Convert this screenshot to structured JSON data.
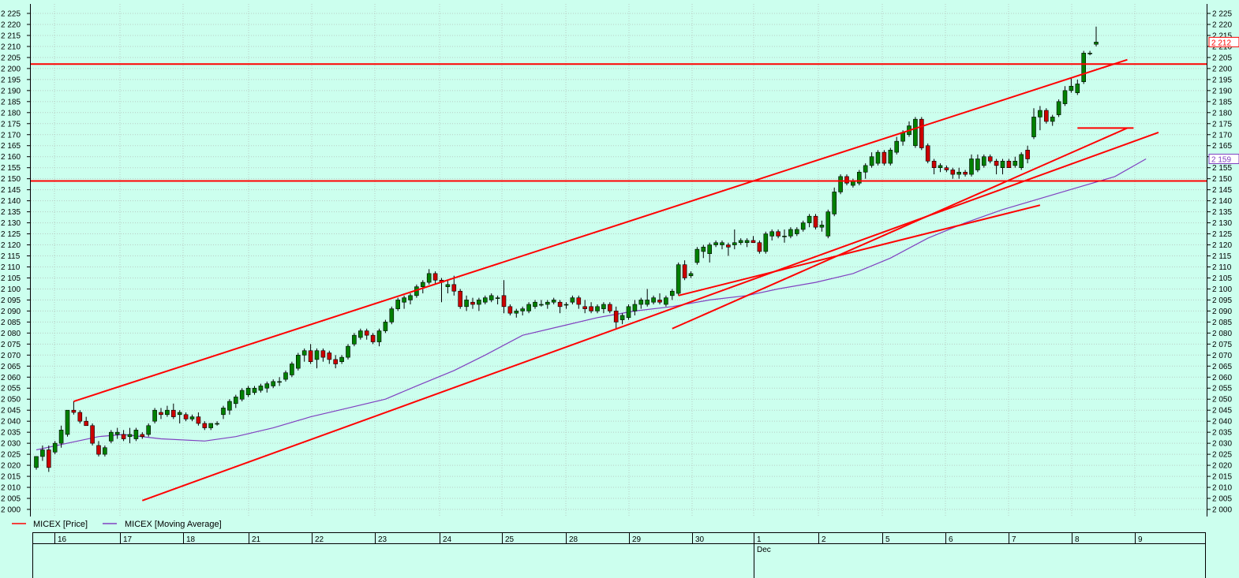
{
  "chart_data": {
    "type": "candlestick",
    "ylim": [
      2000,
      2225
    ],
    "ytick_step": 5,
    "y_tick_labels_left": [
      "2 000",
      "2 005",
      "2 010",
      "2 015",
      "2 020",
      "2 025",
      "2 030",
      "2 035",
      "2 040",
      "2 045",
      "2 050",
      "2 055",
      "2 060",
      "2 065",
      "2 070",
      "2 075",
      "2 080",
      "2 085",
      "2 090",
      "2 095",
      "2 100",
      "2 105",
      "2 110",
      "2 115",
      "2 120",
      "2 125",
      "2 130",
      "2 135",
      "2 140",
      "2 145",
      "2 150",
      "2 155",
      "2 160",
      "2 165",
      "2 170",
      "2 175",
      "2 180",
      "2 185",
      "2 190",
      "2 195",
      "2 200",
      "2 205",
      "2 210",
      "2 215",
      "2 220",
      "2 225"
    ],
    "grid": true,
    "legend": [
      {
        "name": "MICEX [Price]",
        "color": "#FF0000"
      },
      {
        "name": "MICEX [Moving Average]",
        "color": "#8040C0"
      }
    ],
    "date_labels": [
      "16",
      "17",
      "18",
      "21",
      "22",
      "23",
      "24",
      "25",
      "28",
      "29",
      "30",
      "1",
      "2",
      "5",
      "6",
      "7",
      "8",
      "9"
    ],
    "month_label": "Dec",
    "month_label_at": "1",
    "last_price_label": "2 212",
    "ma_value_label": "2 159",
    "candles": [
      {
        "o": 2019,
        "h": 2024,
        "l": 2018,
        "c": 2024
      },
      {
        "o": 2024,
        "h": 2029,
        "l": 2022,
        "c": 2027
      },
      {
        "o": 2027,
        "h": 2029,
        "l": 2017,
        "c": 2019
      },
      {
        "o": 2026,
        "h": 2031,
        "l": 2025,
        "c": 2030
      },
      {
        "o": 2030,
        "h": 2038,
        "l": 2028,
        "c": 2036
      },
      {
        "o": 2034,
        "h": 2045,
        "l": 2033,
        "c": 2045
      },
      {
        "o": 2045,
        "h": 2049,
        "l": 2043,
        "c": 2044
      },
      {
        "o": 2044,
        "h": 2045,
        "l": 2039,
        "c": 2040
      },
      {
        "o": 2040,
        "h": 2042,
        "l": 2038,
        "c": 2038
      },
      {
        "o": 2038,
        "h": 2039,
        "l": 2029,
        "c": 2030
      },
      {
        "o": 2029,
        "h": 2031,
        "l": 2024,
        "c": 2025
      },
      {
        "o": 2025,
        "h": 2029,
        "l": 2024,
        "c": 2028
      },
      {
        "o": 2031,
        "h": 2036,
        "l": 2030,
        "c": 2035
      },
      {
        "o": 2034,
        "h": 2037,
        "l": 2032,
        "c": 2035
      },
      {
        "o": 2034,
        "h": 2036,
        "l": 2031,
        "c": 2032
      },
      {
        "o": 2033,
        "h": 2037,
        "l": 2030,
        "c": 2034
      },
      {
        "o": 2032,
        "h": 2037,
        "l": 2031,
        "c": 2036
      },
      {
        "o": 2034,
        "h": 2035,
        "l": 2032,
        "c": 2033
      },
      {
        "o": 2034,
        "h": 2039,
        "l": 2033,
        "c": 2038
      },
      {
        "o": 2040,
        "h": 2046,
        "l": 2039,
        "c": 2045
      },
      {
        "o": 2044,
        "h": 2046,
        "l": 2041,
        "c": 2043
      },
      {
        "o": 2043,
        "h": 2047,
        "l": 2042,
        "c": 2045
      },
      {
        "o": 2045,
        "h": 2048,
        "l": 2041,
        "c": 2042
      },
      {
        "o": 2043,
        "h": 2045,
        "l": 2039,
        "c": 2044
      },
      {
        "o": 2043,
        "h": 2044,
        "l": 2040,
        "c": 2041
      },
      {
        "o": 2041,
        "h": 2043,
        "l": 2040,
        "c": 2042
      },
      {
        "o": 2042,
        "h": 2044,
        "l": 2038,
        "c": 2039
      },
      {
        "o": 2039,
        "h": 2040,
        "l": 2036,
        "c": 2037
      },
      {
        "o": 2037,
        "h": 2039,
        "l": 2036,
        "c": 2039
      },
      {
        "o": 2039,
        "h": 2040,
        "l": 2038,
        "c": 2039
      },
      {
        "o": 2043,
        "h": 2047,
        "l": 2041,
        "c": 2046
      },
      {
        "o": 2045,
        "h": 2050,
        "l": 2043,
        "c": 2049
      },
      {
        "o": 2048,
        "h": 2052,
        "l": 2046,
        "c": 2051
      },
      {
        "o": 2050,
        "h": 2055,
        "l": 2049,
        "c": 2054
      },
      {
        "o": 2052,
        "h": 2056,
        "l": 2051,
        "c": 2055
      },
      {
        "o": 2053,
        "h": 2056,
        "l": 2052,
        "c": 2055
      },
      {
        "o": 2054,
        "h": 2057,
        "l": 2053,
        "c": 2056
      },
      {
        "o": 2055,
        "h": 2058,
        "l": 2053,
        "c": 2057
      },
      {
        "o": 2056,
        "h": 2059,
        "l": 2055,
        "c": 2058
      },
      {
        "o": 2058,
        "h": 2060,
        "l": 2056,
        "c": 2058
      },
      {
        "o": 2059,
        "h": 2063,
        "l": 2058,
        "c": 2062
      },
      {
        "o": 2061,
        "h": 2067,
        "l": 2060,
        "c": 2066
      },
      {
        "o": 2064,
        "h": 2071,
        "l": 2063,
        "c": 2070
      },
      {
        "o": 2070,
        "h": 2073,
        "l": 2067,
        "c": 2072
      },
      {
        "o": 2072,
        "h": 2075,
        "l": 2066,
        "c": 2067
      },
      {
        "o": 2068,
        "h": 2073,
        "l": 2064,
        "c": 2072
      },
      {
        "o": 2072,
        "h": 2073,
        "l": 2067,
        "c": 2069
      },
      {
        "o": 2071,
        "h": 2072,
        "l": 2066,
        "c": 2068
      },
      {
        "o": 2068,
        "h": 2070,
        "l": 2064,
        "c": 2066
      },
      {
        "o": 2067,
        "h": 2070,
        "l": 2066,
        "c": 2069
      },
      {
        "o": 2069,
        "h": 2075,
        "l": 2068,
        "c": 2074
      },
      {
        "o": 2075,
        "h": 2080,
        "l": 2074,
        "c": 2079
      },
      {
        "o": 2078,
        "h": 2082,
        "l": 2077,
        "c": 2081
      },
      {
        "o": 2081,
        "h": 2082,
        "l": 2077,
        "c": 2079
      },
      {
        "o": 2079,
        "h": 2080,
        "l": 2075,
        "c": 2076
      },
      {
        "o": 2076,
        "h": 2082,
        "l": 2074,
        "c": 2081
      },
      {
        "o": 2081,
        "h": 2086,
        "l": 2080,
        "c": 2085
      },
      {
        "o": 2085,
        "h": 2092,
        "l": 2084,
        "c": 2091
      },
      {
        "o": 2091,
        "h": 2096,
        "l": 2090,
        "c": 2095
      },
      {
        "o": 2094,
        "h": 2097,
        "l": 2091,
        "c": 2096
      },
      {
        "o": 2095,
        "h": 2098,
        "l": 2093,
        "c": 2097
      },
      {
        "o": 2097,
        "h": 2102,
        "l": 2096,
        "c": 2101
      },
      {
        "o": 2101,
        "h": 2104,
        "l": 2098,
        "c": 2103
      },
      {
        "o": 2103,
        "h": 2109,
        "l": 2102,
        "c": 2107
      },
      {
        "o": 2107,
        "h": 2108,
        "l": 2102,
        "c": 2104
      },
      {
        "o": 2104,
        "h": 2105,
        "l": 2094,
        "c": 2103
      },
      {
        "o": 2101,
        "h": 2104,
        "l": 2098,
        "c": 2102
      },
      {
        "o": 2102,
        "h": 2106,
        "l": 2097,
        "c": 2099
      },
      {
        "o": 2099,
        "h": 2100,
        "l": 2091,
        "c": 2092
      },
      {
        "o": 2092,
        "h": 2097,
        "l": 2090,
        "c": 2095
      },
      {
        "o": 2094,
        "h": 2096,
        "l": 2091,
        "c": 2093
      },
      {
        "o": 2093,
        "h": 2096,
        "l": 2090,
        "c": 2095
      },
      {
        "o": 2094,
        "h": 2097,
        "l": 2093,
        "c": 2096
      },
      {
        "o": 2095,
        "h": 2098,
        "l": 2094,
        "c": 2097
      },
      {
        "o": 2096,
        "h": 2097,
        "l": 2093,
        "c": 2096
      },
      {
        "o": 2097,
        "h": 2104,
        "l": 2089,
        "c": 2092
      },
      {
        "o": 2092,
        "h": 2093,
        "l": 2088,
        "c": 2089
      },
      {
        "o": 2089,
        "h": 2091,
        "l": 2087,
        "c": 2090
      },
      {
        "o": 2090,
        "h": 2092,
        "l": 2088,
        "c": 2091
      },
      {
        "o": 2090,
        "h": 2094,
        "l": 2089,
        "c": 2093
      },
      {
        "o": 2092,
        "h": 2095,
        "l": 2091,
        "c": 2094
      },
      {
        "o": 2093,
        "h": 2095,
        "l": 2092,
        "c": 2093
      },
      {
        "o": 2093,
        "h": 2095,
        "l": 2091,
        "c": 2094
      },
      {
        "o": 2094,
        "h": 2096,
        "l": 2093,
        "c": 2095
      },
      {
        "o": 2094,
        "h": 2095,
        "l": 2089,
        "c": 2092
      },
      {
        "o": 2093,
        "h": 2094,
        "l": 2091,
        "c": 2093
      },
      {
        "o": 2094,
        "h": 2097,
        "l": 2093,
        "c": 2096
      },
      {
        "o": 2096,
        "h": 2097,
        "l": 2091,
        "c": 2093
      },
      {
        "o": 2092,
        "h": 2095,
        "l": 2089,
        "c": 2091
      },
      {
        "o": 2092,
        "h": 2094,
        "l": 2089,
        "c": 2090
      },
      {
        "o": 2090,
        "h": 2093,
        "l": 2089,
        "c": 2092
      },
      {
        "o": 2091,
        "h": 2094,
        "l": 2089,
        "c": 2093
      },
      {
        "o": 2093,
        "h": 2094,
        "l": 2089,
        "c": 2090
      },
      {
        "o": 2090,
        "h": 2092,
        "l": 2082,
        "c": 2085
      },
      {
        "o": 2086,
        "h": 2089,
        "l": 2084,
        "c": 2088
      },
      {
        "o": 2087,
        "h": 2093,
        "l": 2086,
        "c": 2092
      },
      {
        "o": 2090,
        "h": 2095,
        "l": 2088,
        "c": 2093
      },
      {
        "o": 2093,
        "h": 2096,
        "l": 2091,
        "c": 2095
      },
      {
        "o": 2093,
        "h": 2100,
        "l": 2092,
        "c": 2095
      },
      {
        "o": 2094,
        "h": 2097,
        "l": 2093,
        "c": 2096
      },
      {
        "o": 2095,
        "h": 2098,
        "l": 2093,
        "c": 2094
      },
      {
        "o": 2093,
        "h": 2097,
        "l": 2092,
        "c": 2096
      },
      {
        "o": 2097,
        "h": 2100,
        "l": 2095,
        "c": 2099
      },
      {
        "o": 2098,
        "h": 2112,
        "l": 2097,
        "c": 2111
      },
      {
        "o": 2111,
        "h": 2113,
        "l": 2104,
        "c": 2105
      },
      {
        "o": 2106,
        "h": 2108,
        "l": 2105,
        "c": 2107
      },
      {
        "o": 2112,
        "h": 2119,
        "l": 2111,
        "c": 2118
      },
      {
        "o": 2117,
        "h": 2120,
        "l": 2114,
        "c": 2119
      },
      {
        "o": 2116,
        "h": 2121,
        "l": 2112,
        "c": 2120
      },
      {
        "o": 2120,
        "h": 2122,
        "l": 2119,
        "c": 2121
      },
      {
        "o": 2120,
        "h": 2122,
        "l": 2118,
        "c": 2121
      },
      {
        "o": 2120,
        "h": 2121,
        "l": 2115,
        "c": 2119
      },
      {
        "o": 2120,
        "h": 2127,
        "l": 2118,
        "c": 2121
      },
      {
        "o": 2121,
        "h": 2123,
        "l": 2120,
        "c": 2122
      },
      {
        "o": 2121,
        "h": 2123,
        "l": 2119,
        "c": 2122
      },
      {
        "o": 2122,
        "h": 2124,
        "l": 2121,
        "c": 2121
      },
      {
        "o": 2121,
        "h": 2122,
        "l": 2116,
        "c": 2117
      },
      {
        "o": 2117,
        "h": 2126,
        "l": 2116,
        "c": 2125
      },
      {
        "o": 2124,
        "h": 2127,
        "l": 2122,
        "c": 2126
      },
      {
        "o": 2126,
        "h": 2127,
        "l": 2123,
        "c": 2124
      },
      {
        "o": 2124,
        "h": 2127,
        "l": 2121,
        "c": 2124
      },
      {
        "o": 2124,
        "h": 2128,
        "l": 2123,
        "c": 2127
      },
      {
        "o": 2125,
        "h": 2128,
        "l": 2124,
        "c": 2127
      },
      {
        "o": 2127,
        "h": 2131,
        "l": 2126,
        "c": 2130
      },
      {
        "o": 2130,
        "h": 2134,
        "l": 2128,
        "c": 2133
      },
      {
        "o": 2133,
        "h": 2134,
        "l": 2127,
        "c": 2128
      },
      {
        "o": 2128,
        "h": 2131,
        "l": 2126,
        "c": 2129
      },
      {
        "o": 2124,
        "h": 2136,
        "l": 2123,
        "c": 2135
      },
      {
        "o": 2134,
        "h": 2146,
        "l": 2133,
        "c": 2144
      },
      {
        "o": 2144,
        "h": 2152,
        "l": 2143,
        "c": 2151
      },
      {
        "o": 2151,
        "h": 2152,
        "l": 2147,
        "c": 2148
      },
      {
        "o": 2147,
        "h": 2150,
        "l": 2146,
        "c": 2149
      },
      {
        "o": 2148,
        "h": 2154,
        "l": 2147,
        "c": 2153
      },
      {
        "o": 2153,
        "h": 2157,
        "l": 2150,
        "c": 2156
      },
      {
        "o": 2156,
        "h": 2162,
        "l": 2155,
        "c": 2160
      },
      {
        "o": 2157,
        "h": 2163,
        "l": 2156,
        "c": 2162
      },
      {
        "o": 2162,
        "h": 2163,
        "l": 2156,
        "c": 2157
      },
      {
        "o": 2157,
        "h": 2164,
        "l": 2156,
        "c": 2163
      },
      {
        "o": 2162,
        "h": 2169,
        "l": 2161,
        "c": 2167
      },
      {
        "o": 2167,
        "h": 2172,
        "l": 2165,
        "c": 2171
      },
      {
        "o": 2170,
        "h": 2176,
        "l": 2169,
        "c": 2174
      },
      {
        "o": 2165,
        "h": 2178,
        "l": 2164,
        "c": 2177
      },
      {
        "o": 2177,
        "h": 2178,
        "l": 2163,
        "c": 2164
      },
      {
        "o": 2165,
        "h": 2166,
        "l": 2157,
        "c": 2158
      },
      {
        "o": 2158,
        "h": 2159,
        "l": 2152,
        "c": 2155
      },
      {
        "o": 2155,
        "h": 2157,
        "l": 2153,
        "c": 2156
      },
      {
        "o": 2155,
        "h": 2156,
        "l": 2153,
        "c": 2154
      },
      {
        "o": 2154,
        "h": 2155,
        "l": 2150,
        "c": 2152
      },
      {
        "o": 2152,
        "h": 2155,
        "l": 2150,
        "c": 2153
      },
      {
        "o": 2153,
        "h": 2154,
        "l": 2151,
        "c": 2152
      },
      {
        "o": 2152,
        "h": 2161,
        "l": 2151,
        "c": 2159
      },
      {
        "o": 2154,
        "h": 2161,
        "l": 2153,
        "c": 2159
      },
      {
        "o": 2156,
        "h": 2161,
        "l": 2155,
        "c": 2160
      },
      {
        "o": 2160,
        "h": 2161,
        "l": 2157,
        "c": 2158
      },
      {
        "o": 2158,
        "h": 2159,
        "l": 2152,
        "c": 2156
      },
      {
        "o": 2155,
        "h": 2159,
        "l": 2152,
        "c": 2158
      },
      {
        "o": 2158,
        "h": 2159,
        "l": 2155,
        "c": 2155
      },
      {
        "o": 2156,
        "h": 2160,
        "l": 2155,
        "c": 2158
      },
      {
        "o": 2155,
        "h": 2162,
        "l": 2154,
        "c": 2161
      },
      {
        "o": 2163,
        "h": 2165,
        "l": 2157,
        "c": 2159
      },
      {
        "o": 2169,
        "h": 2182,
        "l": 2168,
        "c": 2178
      },
      {
        "o": 2178,
        "h": 2183,
        "l": 2172,
        "c": 2181
      },
      {
        "o": 2181,
        "h": 2182,
        "l": 2175,
        "c": 2176
      },
      {
        "o": 2176,
        "h": 2179,
        "l": 2174,
        "c": 2178
      },
      {
        "o": 2179,
        "h": 2186,
        "l": 2178,
        "c": 2185
      },
      {
        "o": 2184,
        "h": 2192,
        "l": 2183,
        "c": 2190
      },
      {
        "o": 2190,
        "h": 2196,
        "l": 2189,
        "c": 2192
      },
      {
        "o": 2189,
        "h": 2195,
        "l": 2188,
        "c": 2193
      },
      {
        "o": 2194,
        "h": 2208,
        "l": 2193,
        "c": 2207
      },
      {
        "o": 2207,
        "h": 2208,
        "l": 2206,
        "c": 2207
      },
      {
        "o": 2211,
        "h": 2219,
        "l": 2210,
        "c": 2212
      }
    ],
    "moving_average": [
      [
        0,
        2027
      ],
      [
        5,
        2030
      ],
      [
        10,
        2033
      ],
      [
        14,
        2034
      ],
      [
        20,
        2032
      ],
      [
        27,
        2031
      ],
      [
        32,
        2033
      ],
      [
        38,
        2037
      ],
      [
        44,
        2042
      ],
      [
        50,
        2046
      ],
      [
        56,
        2050
      ],
      [
        61,
        2056
      ],
      [
        67,
        2063
      ],
      [
        72,
        2070
      ],
      [
        78,
        2079
      ],
      [
        84,
        2083
      ],
      [
        90,
        2087
      ],
      [
        96,
        2090
      ],
      [
        102,
        2092
      ],
      [
        108,
        2095
      ],
      [
        114,
        2097
      ],
      [
        119,
        2100
      ],
      [
        125,
        2103
      ],
      [
        131,
        2107
      ],
      [
        137,
        2114
      ],
      [
        143,
        2123
      ],
      [
        149,
        2130
      ],
      [
        155,
        2136
      ],
      [
        161,
        2141
      ],
      [
        167,
        2146
      ],
      [
        173,
        2151
      ],
      [
        178,
        2159
      ]
    ],
    "horizontal_lines": [
      2202,
      2149
    ],
    "trend_lines": [
      {
        "from": [
          6,
          2049
        ],
        "to": [
          175,
          2204
        ]
      },
      {
        "from": [
          17,
          2004
        ],
        "to": [
          180,
          2171
        ]
      },
      {
        "from": [
          102,
          2082
        ],
        "to": [
          175,
          2173
        ]
      },
      {
        "from": [
          103,
          2097
        ],
        "to": [
          161,
          2138
        ]
      },
      {
        "from": [
          167,
          2173
        ],
        "to": [
          176,
          2173
        ]
      }
    ]
  }
}
